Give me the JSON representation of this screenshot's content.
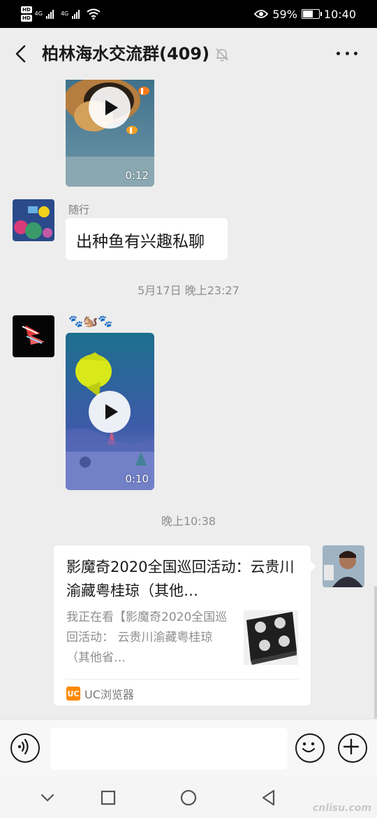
{
  "status_bar": {
    "hd_badge_1": "HD",
    "hd_badge_2": "HD",
    "network_1": "4G",
    "network_2": "4G",
    "battery_percent": "59%",
    "battery_level": 0.59,
    "time": "10:40"
  },
  "header": {
    "title": "柏林海水交流群(409)",
    "muted": true
  },
  "messages": [
    {
      "type": "video",
      "duration": "0:12"
    },
    {
      "type": "text",
      "sender": "随行",
      "text": "出种鱼有兴趣私聊"
    },
    {
      "type": "timestamp",
      "text": "5月17日 晚上23:27"
    },
    {
      "type": "video",
      "sender_emoji": "🐾🐿️🐾",
      "duration": "0:10"
    },
    {
      "type": "timestamp",
      "text": "晚上10:38"
    },
    {
      "type": "link_card",
      "title": "影魔奇2020全国巡回活动：云贵川渝藏粤桂琼（其他…",
      "description": "我正在看【影魔奇2020全国巡回活动： 云贵川渝藏粤桂琼（其他省…",
      "source": "UC浏览器",
      "source_icon_text": "UC"
    }
  ],
  "input_bar": {
    "placeholder": ""
  },
  "watermark": "cnlisu.com",
  "colors": {
    "background": "#ededed",
    "bubble": "#ffffff",
    "text": "#191919",
    "muted_text": "#8e8e8e",
    "uc_orange": "#ff8a00"
  }
}
